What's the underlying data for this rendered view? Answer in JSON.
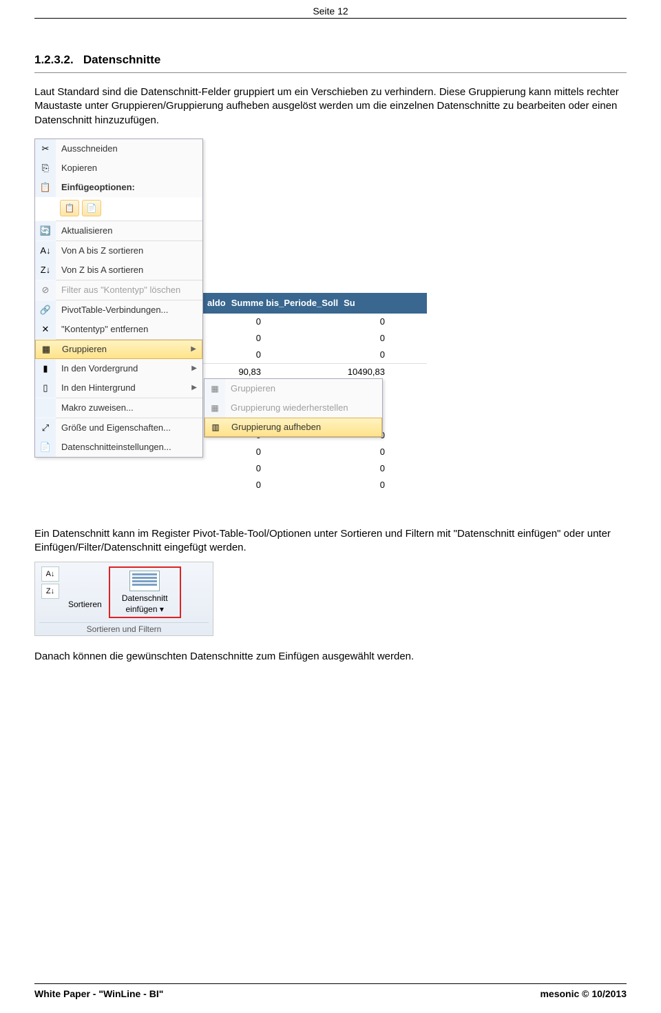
{
  "page_header": "Seite 12",
  "section_number": "1.2.3.2.",
  "section_title": "Datenschnitte",
  "paragraph1": "Laut Standard sind die Datenschnitt-Felder gruppiert um ein Verschieben zu verhindern. Diese Gruppierung kann mittels rechter Maustaste unter Gruppieren/Gruppierung aufheben ausgelöst werden um die einzelnen Datenschnitte zu bearbeiten oder einen Datenschnitt hinzuzufügen.",
  "ctxmenu": {
    "cut": "Ausschneiden",
    "copy": "Kopieren",
    "paste_options": "Einfügeoptionen:",
    "refresh": "Aktualisieren",
    "sortAZ": "Von A bis Z sortieren",
    "sortZA": "Von Z bis A sortieren",
    "filter_clear": "Filter aus \"Kontentyp\" löschen",
    "pivot_conn": "PivotTable-Verbindungen...",
    "remove": "\"Kontentyp\" entfernen",
    "group": "Gruppieren",
    "to_front": "In den Vordergrund",
    "to_back": "In den Hintergrund",
    "assign_macro": "Makro zuweisen...",
    "size_props": "Größe und Eigenschaften...",
    "settings": "Datenschnitteinstellungen..."
  },
  "submenu": {
    "group": "Gruppieren",
    "regroup": "Gruppierung wiederherstellen",
    "ungroup": "Gruppierung aufheben"
  },
  "pivot_header": {
    "c1": "aldo",
    "c2": "Summe bis_Periode_Soll",
    "c3": "Su"
  },
  "pivot_rows_top": [
    {
      "c1": "0",
      "c2": "0"
    },
    {
      "c1": "0",
      "c2": "0"
    },
    {
      "c1": "0",
      "c2": "0"
    },
    {
      "c1": "90,83",
      "c2": "10490,83"
    }
  ],
  "pivot_rows_bottom": [
    {
      "c1": "0",
      "c2": "0"
    },
    {
      "c1": "0",
      "c2": "0"
    },
    {
      "c1": "0",
      "c2": "0"
    },
    {
      "c1": "0",
      "c2": "0"
    }
  ],
  "paragraph2": "Ein Datenschnitt kann im Register Pivot-Table-Tool/Optionen unter Sortieren und Filtern mit \"Datenschnitt einfügen\" oder unter Einfügen/Filter/Datenschnitt eingefügt werden.",
  "ribbon": {
    "sort": "Sortieren",
    "insert_slicer_l1": "Datenschnitt",
    "insert_slicer_l2": "einfügen",
    "group_caption": "Sortieren und Filtern"
  },
  "paragraph3": "Danach können die gewünschten Datenschnitte zum Einfügen ausgewählt werden.",
  "footer_left": "White Paper - \"WinLine - BI\"",
  "footer_right": "mesonic © 10/2013"
}
